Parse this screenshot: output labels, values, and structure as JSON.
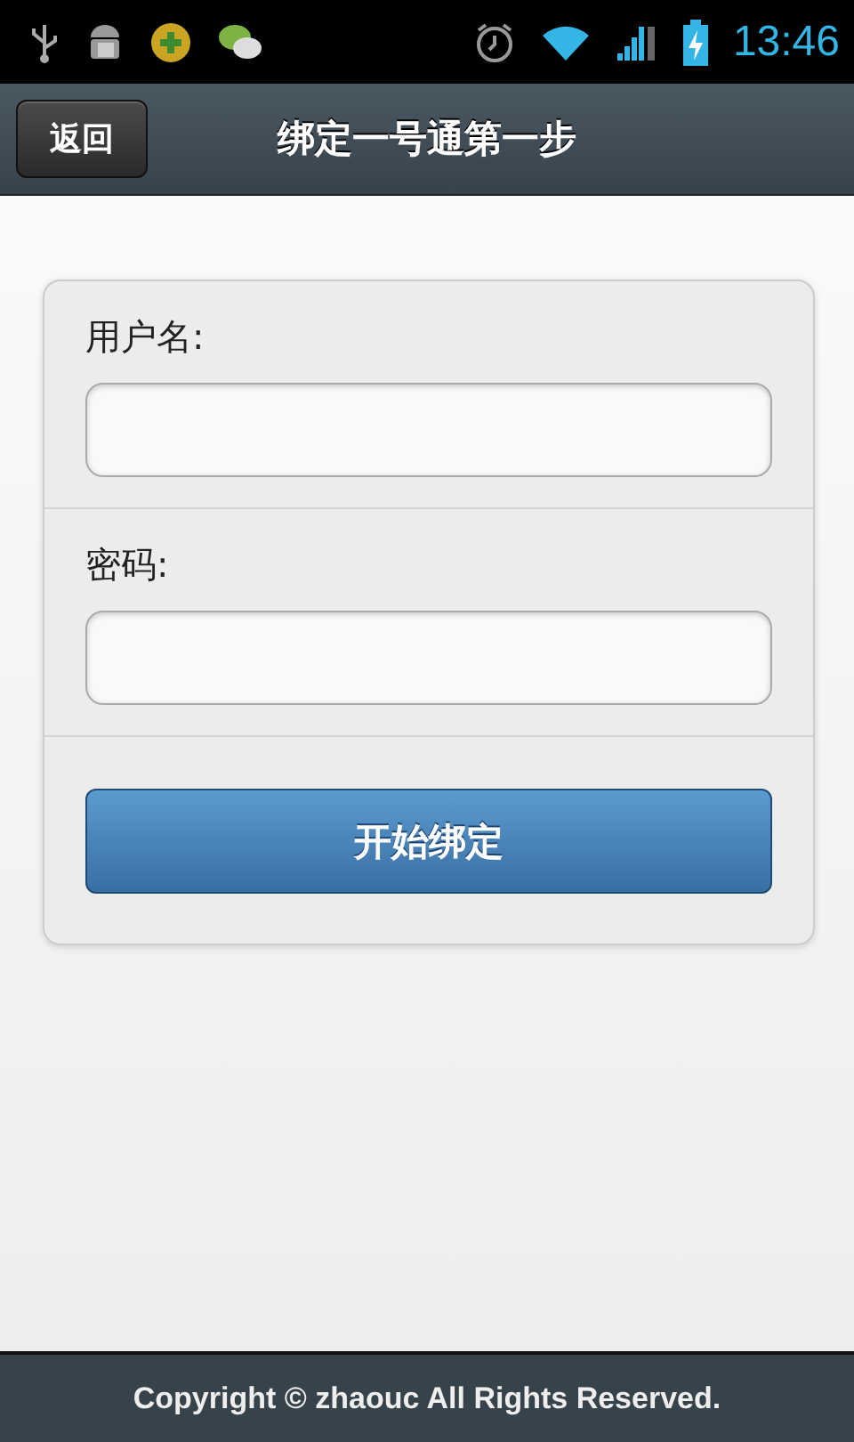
{
  "status_bar": {
    "time": "13:46"
  },
  "header": {
    "back_button": "返回",
    "title": "绑定一号通第一步"
  },
  "form": {
    "fields": [
      {
        "label": "用户名:"
      },
      {
        "label": "密码:"
      }
    ],
    "submit_button": "开始绑定"
  },
  "footer": {
    "text": "Copyright © zhaouc All Rights Reserved."
  }
}
